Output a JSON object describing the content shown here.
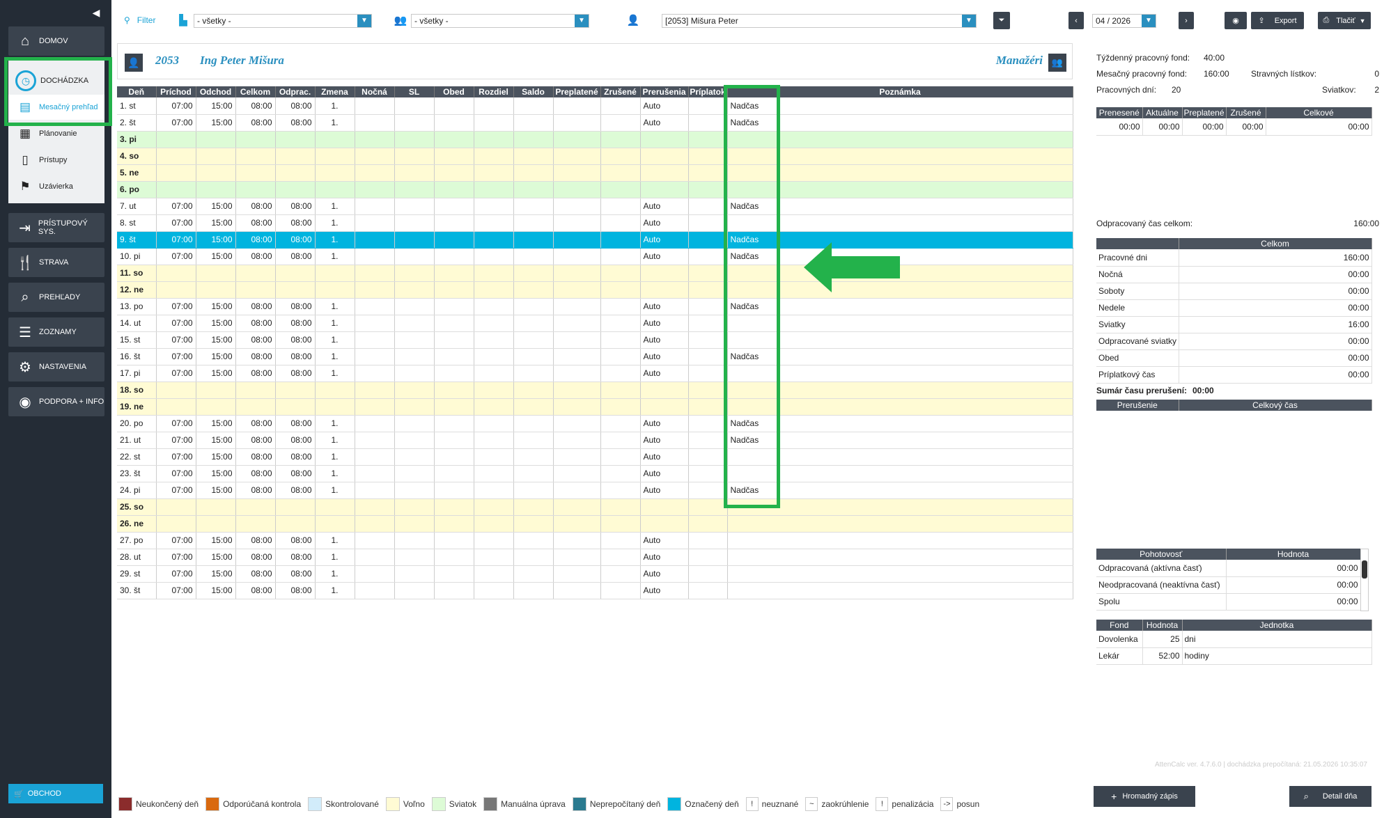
{
  "sidebar": {
    "items": [
      {
        "label": "DOMOV",
        "icon": "home-icon"
      },
      {
        "label": "DOCHÁDZKA",
        "icon": "clock-icon"
      },
      {
        "label": "Mesačný prehľad",
        "icon": "book-icon"
      },
      {
        "label": "Plánovanie",
        "icon": "calendar-icon"
      },
      {
        "label": "Prístupy",
        "icon": "door-icon"
      },
      {
        "label": "Uzávierka",
        "icon": "checkered-flag-icon"
      },
      {
        "label": "PRÍSTUPOVÝ SYS.",
        "icon": "login-icon"
      },
      {
        "label": "STRAVA",
        "icon": "cutlery-icon"
      },
      {
        "label": "PREHĽADY",
        "icon": "search-icon"
      },
      {
        "label": "ZOZNAMY",
        "icon": "list-icon"
      },
      {
        "label": "NASTAVENIA",
        "icon": "gear-icon"
      },
      {
        "label": "PODPORA + INFO",
        "icon": "lifebuoy-icon"
      }
    ],
    "shop": "OBCHOD"
  },
  "toolbar": {
    "filter_label": "Filter",
    "dept_value": "- všetky -",
    "group_value": "- všetky -",
    "employee_value": "[2053] Mišura Peter",
    "period": "04 / 2026",
    "export_label": "Export",
    "print_label": "Tlačiť"
  },
  "employee": {
    "number": "2053",
    "name": "Ing Peter Mišura",
    "group": "Manažéri"
  },
  "table": {
    "columns": [
      "Deň",
      "Príchod",
      "Odchod",
      "Celkom",
      "Odprac.",
      "Zmena",
      "Nočná",
      "SL",
      "Obed",
      "Rozdiel",
      "Saldo",
      "Preplatené",
      "Zrušené",
      "Prerušenia",
      "Príplatok",
      "Poznámka"
    ],
    "rows": [
      {
        "day": "1. st",
        "type": "work",
        "in": "07:00",
        "out": "15:00",
        "total": "08:00",
        "worked": "08:00",
        "shift": "1.",
        "pr": "Auto",
        "note": "Nadčas"
      },
      {
        "day": "2. št",
        "type": "work",
        "in": "07:00",
        "out": "15:00",
        "total": "08:00",
        "worked": "08:00",
        "shift": "1.",
        "pr": "Auto",
        "note": "Nadčas"
      },
      {
        "day": "3. pi",
        "type": "holiday"
      },
      {
        "day": "4. so",
        "type": "weekend"
      },
      {
        "day": "5. ne",
        "type": "weekend"
      },
      {
        "day": "6. po",
        "type": "holiday"
      },
      {
        "day": "7. ut",
        "type": "work",
        "in": "07:00",
        "out": "15:00",
        "total": "08:00",
        "worked": "08:00",
        "shift": "1.",
        "pr": "Auto",
        "note": "Nadčas"
      },
      {
        "day": "8. st",
        "type": "work",
        "in": "07:00",
        "out": "15:00",
        "total": "08:00",
        "worked": "08:00",
        "shift": "1.",
        "pr": "Auto",
        "note": ""
      },
      {
        "day": "9. št",
        "type": "selected",
        "in": "07:00",
        "out": "15:00",
        "total": "08:00",
        "worked": "08:00",
        "shift": "1.",
        "pr": "Auto",
        "note": "Nadčas"
      },
      {
        "day": "10. pi",
        "type": "work",
        "in": "07:00",
        "out": "15:00",
        "total": "08:00",
        "worked": "08:00",
        "shift": "1.",
        "pr": "Auto",
        "note": "Nadčas"
      },
      {
        "day": "11. so",
        "type": "weekend"
      },
      {
        "day": "12. ne",
        "type": "weekend"
      },
      {
        "day": "13. po",
        "type": "work",
        "in": "07:00",
        "out": "15:00",
        "total": "08:00",
        "worked": "08:00",
        "shift": "1.",
        "pr": "Auto",
        "note": "Nadčas"
      },
      {
        "day": "14. ut",
        "type": "work",
        "in": "07:00",
        "out": "15:00",
        "total": "08:00",
        "worked": "08:00",
        "shift": "1.",
        "pr": "Auto",
        "note": ""
      },
      {
        "day": "15. st",
        "type": "work",
        "in": "07:00",
        "out": "15:00",
        "total": "08:00",
        "worked": "08:00",
        "shift": "1.",
        "pr": "Auto",
        "note": ""
      },
      {
        "day": "16. št",
        "type": "work",
        "in": "07:00",
        "out": "15:00",
        "total": "08:00",
        "worked": "08:00",
        "shift": "1.",
        "pr": "Auto",
        "note": "Nadčas"
      },
      {
        "day": "17. pi",
        "type": "work",
        "in": "07:00",
        "out": "15:00",
        "total": "08:00",
        "worked": "08:00",
        "shift": "1.",
        "pr": "Auto",
        "note": ""
      },
      {
        "day": "18. so",
        "type": "weekend"
      },
      {
        "day": "19. ne",
        "type": "weekend"
      },
      {
        "day": "20. po",
        "type": "work",
        "in": "07:00",
        "out": "15:00",
        "total": "08:00",
        "worked": "08:00",
        "shift": "1.",
        "pr": "Auto",
        "note": "Nadčas"
      },
      {
        "day": "21. ut",
        "type": "work",
        "in": "07:00",
        "out": "15:00",
        "total": "08:00",
        "worked": "08:00",
        "shift": "1.",
        "pr": "Auto",
        "note": "Nadčas"
      },
      {
        "day": "22. st",
        "type": "work",
        "in": "07:00",
        "out": "15:00",
        "total": "08:00",
        "worked": "08:00",
        "shift": "1.",
        "pr": "Auto",
        "note": ""
      },
      {
        "day": "23. št",
        "type": "work",
        "in": "07:00",
        "out": "15:00",
        "total": "08:00",
        "worked": "08:00",
        "shift": "1.",
        "pr": "Auto",
        "note": ""
      },
      {
        "day": "24. pi",
        "type": "work",
        "in": "07:00",
        "out": "15:00",
        "total": "08:00",
        "worked": "08:00",
        "shift": "1.",
        "pr": "Auto",
        "note": "Nadčas"
      },
      {
        "day": "25. so",
        "type": "weekend"
      },
      {
        "day": "26. ne",
        "type": "weekend"
      },
      {
        "day": "27. po",
        "type": "work",
        "in": "07:00",
        "out": "15:00",
        "total": "08:00",
        "worked": "08:00",
        "shift": "1.",
        "pr": "Auto",
        "note": ""
      },
      {
        "day": "28. ut",
        "type": "work",
        "in": "07:00",
        "out": "15:00",
        "total": "08:00",
        "worked": "08:00",
        "shift": "1.",
        "pr": "Auto",
        "note": ""
      },
      {
        "day": "29. st",
        "type": "work",
        "in": "07:00",
        "out": "15:00",
        "total": "08:00",
        "worked": "08:00",
        "shift": "1.",
        "pr": "Auto",
        "note": ""
      },
      {
        "day": "30. št",
        "type": "work",
        "in": "07:00",
        "out": "15:00",
        "total": "08:00",
        "worked": "08:00",
        "shift": "1.",
        "pr": "Auto",
        "note": ""
      }
    ]
  },
  "summary": {
    "weekly_fund_label": "Týždenný pracovný fond:",
    "weekly_fund": "40:00",
    "monthly_fund_label": "Mesačný pracovný fond:",
    "monthly_fund": "160:00",
    "meal_label": "Stravných lístkov:",
    "meal": "0",
    "workdays_label": "Pracovných dní:",
    "workdays": "20",
    "holidays_label": "Sviatkov:",
    "holidays": "2",
    "balance_cols": [
      "Prenesené",
      "Aktuálne",
      "Preplatené",
      "Zrušené",
      "Celkové"
    ],
    "balance_vals": [
      "00:00",
      "00:00",
      "00:00",
      "00:00",
      "00:00"
    ],
    "worked_total_label": "Odpracovaný čas celkom:",
    "worked_total": "160:00",
    "breakdown_header": "Celkom",
    "breakdown": [
      {
        "label": "Pracovné dni",
        "value": "160:00"
      },
      {
        "label": "Nočná",
        "value": "00:00"
      },
      {
        "label": "Soboty",
        "value": "00:00"
      },
      {
        "label": "Nedele",
        "value": "00:00"
      },
      {
        "label": "Sviatky",
        "value": "16:00"
      },
      {
        "label": "Odpracované sviatky",
        "value": "00:00"
      },
      {
        "label": "Obed",
        "value": "00:00"
      },
      {
        "label": "Príplatkový čas",
        "value": "00:00"
      }
    ],
    "interrupt_sum_label": "Sumár času prerušení:",
    "interrupt_sum": "00:00",
    "interrupt_cols": [
      "Prerušenie",
      "Celkový čas"
    ],
    "standby_cols": [
      "Pohotovosť",
      "Hodnota"
    ],
    "standby": [
      {
        "label": "Odpracovaná (aktívna časť)",
        "value": "00:00"
      },
      {
        "label": "Neodpracovaná (neaktívna časť)",
        "value": "00:00"
      },
      {
        "label": "Spolu",
        "value": "00:00"
      }
    ],
    "fund_cols": [
      "Fond",
      "Hodnota",
      "Jednotka"
    ],
    "funds": [
      {
        "fond": "Dovolenka",
        "value": "25",
        "unit": "dni"
      },
      {
        "fond": "Lekár",
        "value": "52:00",
        "unit": "hodiny"
      }
    ],
    "version": "AttenCalc ver. 4.7.6.0 | dochádzka prepočítaná: 21.05.2026 10:35:07"
  },
  "legend": [
    {
      "color": "#8b2c2c",
      "label": "Neukončený deň"
    },
    {
      "color": "#d9690f",
      "label": "Odporúčaná kontrola"
    },
    {
      "color": "#d2ecfa",
      "label": "Skontrolované"
    },
    {
      "color": "#fffbd4",
      "label": "Voľno"
    },
    {
      "color": "#ddfbd6",
      "label": "Sviatok"
    },
    {
      "color": "#777777",
      "label": "Manuálna úprava"
    },
    {
      "color": "#2a7a8f",
      "label": "Neprepočítaný deň"
    },
    {
      "color": "#00b4df",
      "label": "Označený deň"
    }
  ],
  "legend_symbols": [
    {
      "sym": "!",
      "label": "neuznané"
    },
    {
      "sym": "~",
      "label": "zaokrúhlenie"
    },
    {
      "sym": "!",
      "label": "penalizácia"
    },
    {
      "sym": "->",
      "label": "posun"
    }
  ],
  "buttons": {
    "bulk": "Hromadný zápis",
    "detail": "Detail dňa"
  }
}
